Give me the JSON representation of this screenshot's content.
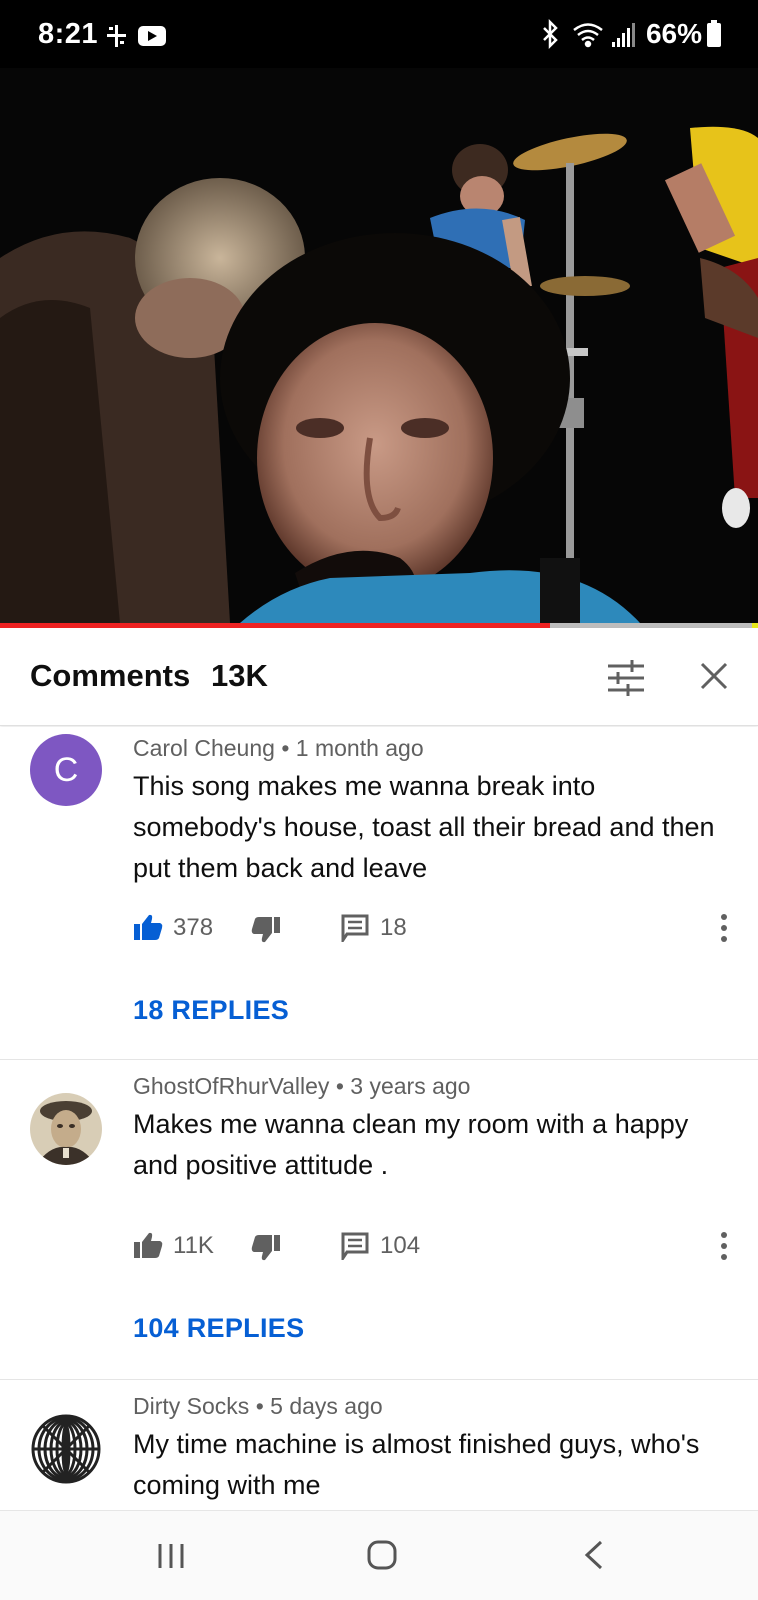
{
  "status_bar": {
    "time": "8:21",
    "battery": "66%",
    "icons": [
      "fan-icon",
      "youtube-icon",
      "bluetooth-icon",
      "wifi-icon",
      "signal-icon",
      "battery-icon"
    ]
  },
  "video": {
    "progress": 0.726
  },
  "comments_panel": {
    "title": "Comments",
    "count": "13K",
    "icons": [
      "filter-sliders-icon",
      "close-icon"
    ]
  },
  "comments": [
    {
      "avatar_letter": "C",
      "author": "Carol Cheung",
      "time": "1 month ago",
      "text": "This song makes me wanna break into somebody's house, toast all their bread and then put them back and leave",
      "likes": "378",
      "reply_count": "18",
      "replies_label": "18 REPLIES",
      "liked": true
    },
    {
      "avatar_letter": "",
      "author": "GhostOfRhurValley",
      "time": "3 years ago",
      "text": "Makes me wanna clean my room with a happy and positive attitude .",
      "likes": "11K",
      "reply_count": "104",
      "replies_label": "104 REPLIES",
      "liked": false
    },
    {
      "avatar_letter": "",
      "author": "Dirty Socks",
      "time": "5 days ago",
      "text": "My time machine is almost finished guys, who's coming with me",
      "likes": "",
      "reply_count": "",
      "replies_label": "",
      "liked": false
    }
  ],
  "nav_bar": {
    "icons": [
      "recents-icon",
      "home-icon",
      "back-icon"
    ]
  },
  "colors": {
    "accent_blue": "#065fd4",
    "progress_red": "#ee2222",
    "avatar_purple": "#7e57c2"
  }
}
